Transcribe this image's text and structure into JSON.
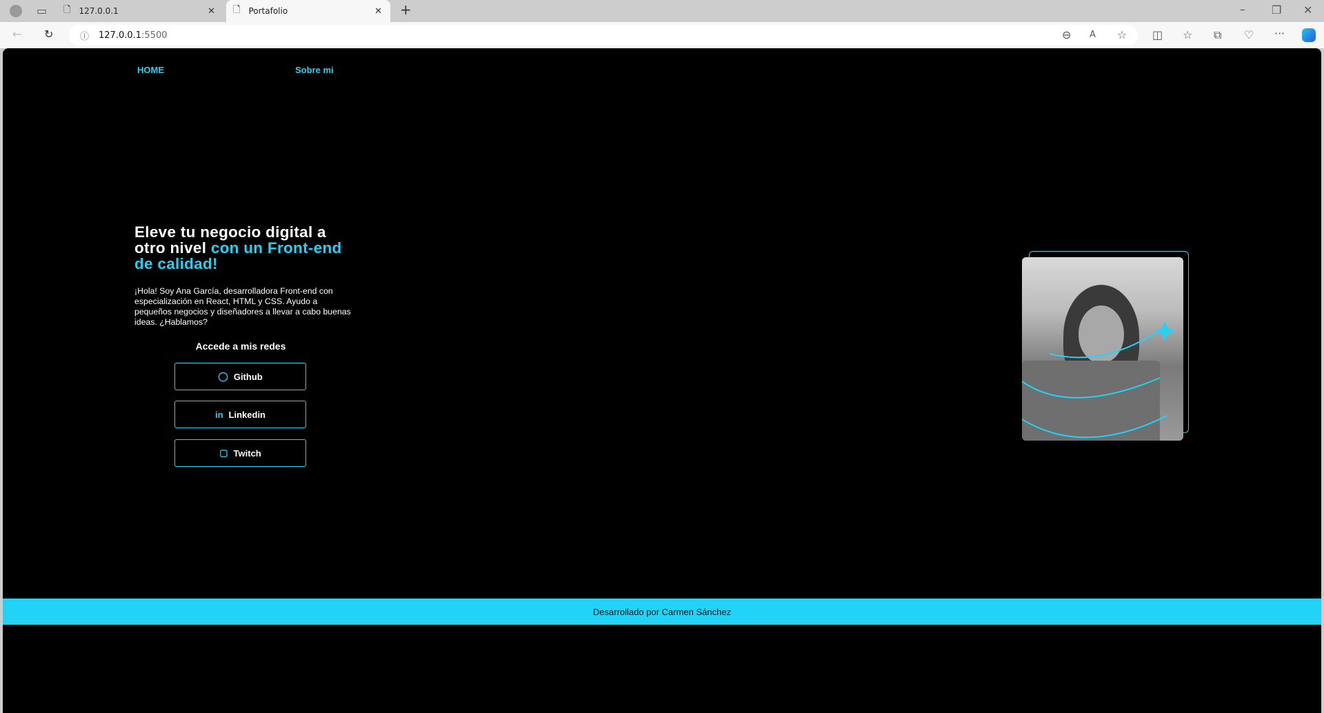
{
  "browser": {
    "tabs": [
      {
        "title": "127.0.0.1"
      },
      {
        "title": "Portafolio"
      }
    ],
    "url_host": "127.0.0.1",
    "url_port": ":5500"
  },
  "nav": {
    "items": [
      {
        "label": "HOME"
      },
      {
        "label": "Sobre mi"
      }
    ]
  },
  "hero": {
    "title_white": "Eleve tu negocio digital a otro nivel ",
    "title_accent": "con un Front-end de calidad!",
    "intro": "¡Hola! Soy Ana García, desarrolladora Front-end con especialización en React, HTML y CSS. Ayudo a pequeños negocios y diseñadores a llevar a cabo buenas ideas. ¿Hablamos?",
    "social_heading": "Accede a mis redes",
    "buttons": [
      {
        "label": "Github",
        "icon": "github-icon"
      },
      {
        "label": "Linkedin",
        "icon": "linkedin-icon"
      },
      {
        "label": "Twitch",
        "icon": "twitch-icon"
      }
    ]
  },
  "footer": {
    "text": "Desarrollado por Carmen Sánchez"
  },
  "colors": {
    "accent": "#22d3f7",
    "background": "#000000"
  }
}
